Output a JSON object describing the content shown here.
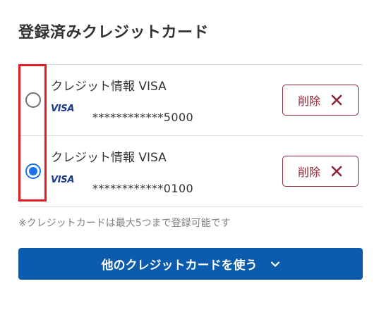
{
  "section": {
    "title": "登録済みクレジットカード"
  },
  "cards": [
    {
      "name": "クレジット情報 VISA",
      "brand": "VISA",
      "number": "************5000",
      "selected": false,
      "delete_label": "削除"
    },
    {
      "name": "クレジット情報 VISA",
      "brand": "VISA",
      "number": "************0100",
      "selected": true,
      "delete_label": "削除"
    }
  ],
  "note": "※クレジットカードは最大5つまで登録可能です",
  "other_card_button": {
    "label": "他のクレジットカードを使う"
  },
  "colors": {
    "accent": "#1a73e8",
    "delete": "#8c2434",
    "primary_button": "#0b5cad",
    "highlight": "#e01b24",
    "visa": "#1a3a8c"
  },
  "icons": {
    "delete": "close-icon",
    "expand": "chevron-down-icon"
  }
}
